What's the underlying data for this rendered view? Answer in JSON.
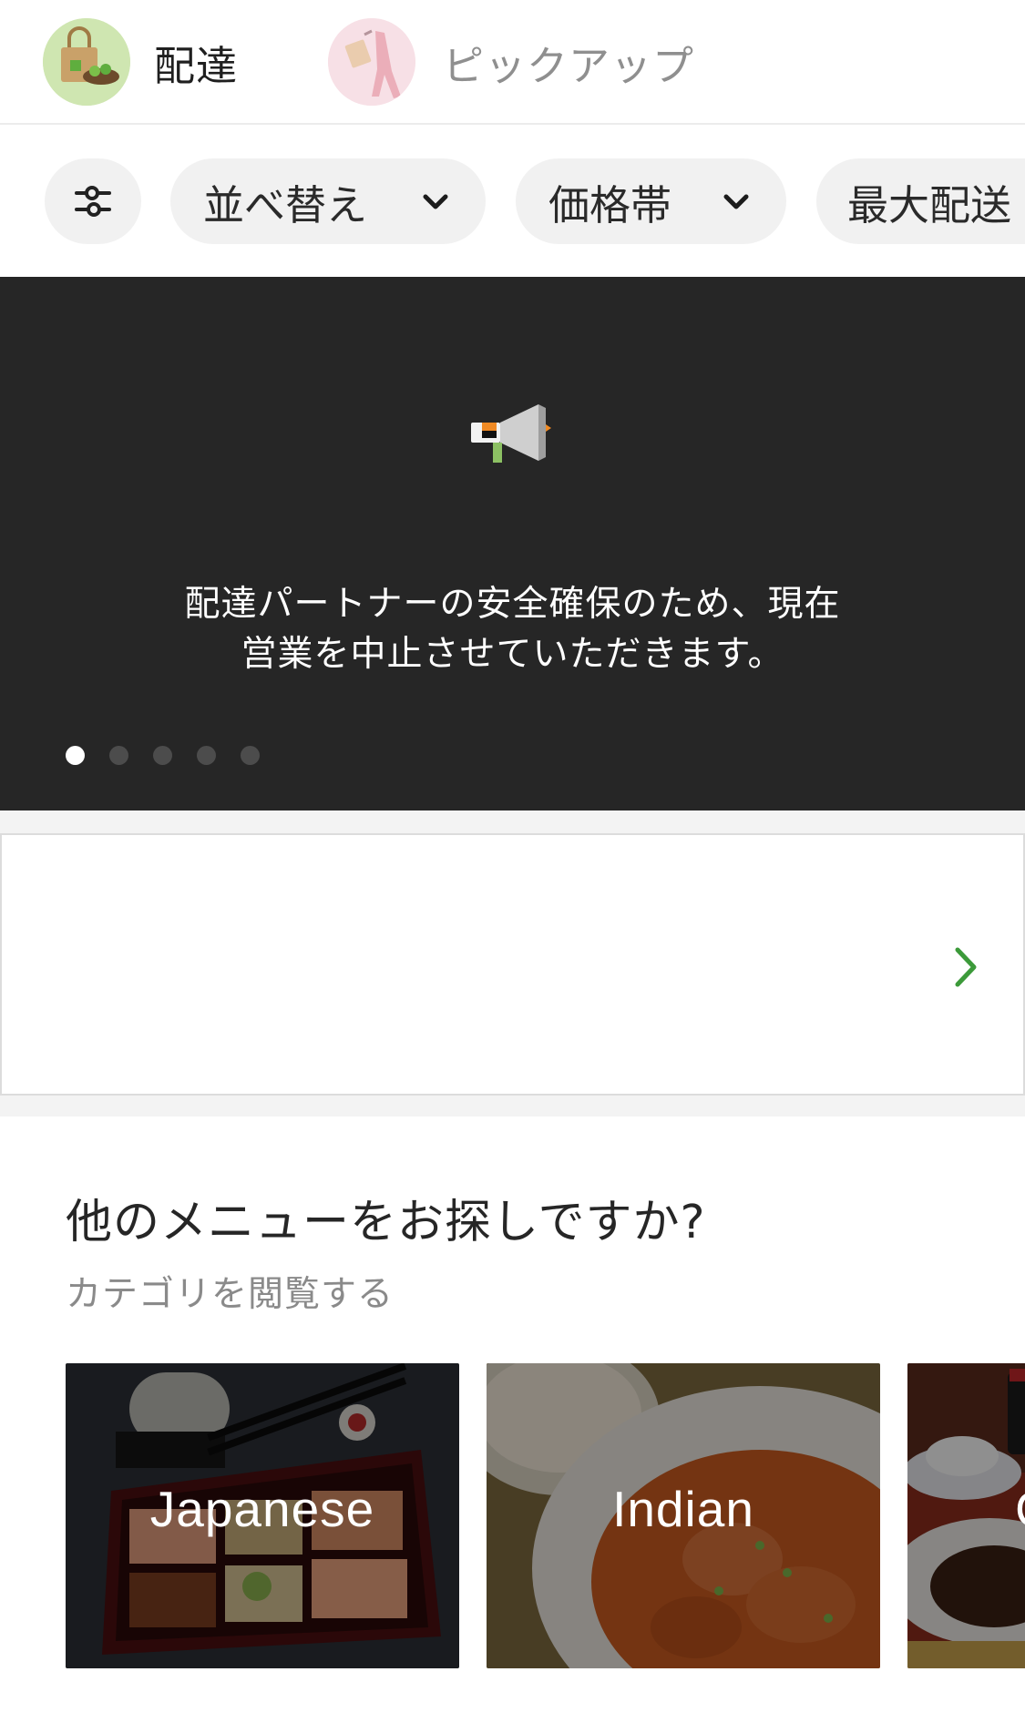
{
  "mode_tabs": [
    {
      "label": "配達",
      "icon": "delivery-bag-icon"
    },
    {
      "label": "ピックアップ",
      "icon": "pickup-walker-icon"
    }
  ],
  "filters": {
    "filter_icon": "sliders-icon",
    "sort_label": "並べ替え",
    "price_label": "価格帯",
    "max_fee_label": "最大配送"
  },
  "banner": {
    "icon": "megaphone-icon",
    "line1": "配達パートナーの安全確保のため、現在",
    "line2": "営業を中止させていただきます。",
    "page_count": 5,
    "active_page": 1,
    "background": "#262626"
  },
  "promo_card": {
    "chevron_color": "#3c9a3a"
  },
  "categories": {
    "title": "他のメニューをお探しですか?",
    "subtitle": "カテゴリを閲覧する",
    "items": [
      {
        "label": "Japanese"
      },
      {
        "label": "Indian"
      },
      {
        "label": "C"
      }
    ]
  },
  "colors": {
    "accent_green": "#3c9a3a",
    "chip_bg": "#f1f1f1",
    "muted_text": "#8a8a8a"
  }
}
